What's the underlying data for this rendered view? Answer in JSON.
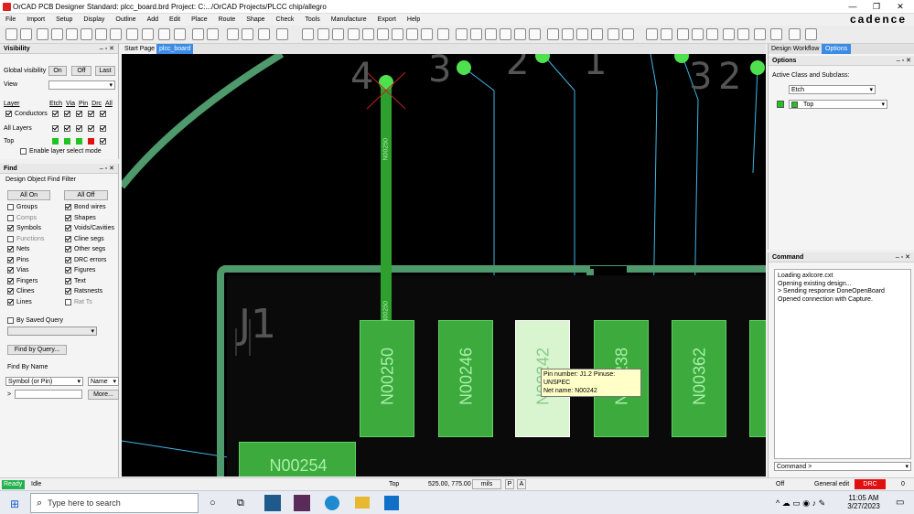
{
  "window": {
    "title": "OrCAD PCB Designer Standard: plcc_board.brd  Project: C:.../OrCAD Projects/PLCC chip/allegro",
    "min": "—",
    "max": "❐",
    "close": "✕",
    "brand": "cadence"
  },
  "menu": [
    "File",
    "Import",
    "Setup",
    "Display",
    "Outline",
    "Add",
    "Edit",
    "Place",
    "Route",
    "Shape",
    "Check",
    "Tools",
    "Manufacture",
    "Export",
    "Help"
  ],
  "tabs": {
    "start": "Start Page",
    "board": "plcc_board"
  },
  "visibility": {
    "title": "Visibility",
    "global_label": "Global visibility",
    "on": "On",
    "off": "Off",
    "last": "Last",
    "view_label": "View",
    "layer_label": "Layer",
    "cols": [
      "Etch",
      "Via",
      "Pin",
      "Drc",
      "All"
    ],
    "conductors": "Conductors",
    "all_layers": "All Layers",
    "top": "Top",
    "enable_layer_select": "Enable layer select mode"
  },
  "find": {
    "title": "Find",
    "filter_title": "Design Object Find Filter",
    "all_on": "All On",
    "all_off": "All Off",
    "left": [
      {
        "label": "Groups",
        "on": false
      },
      {
        "label": "Comps",
        "on": false,
        "dim": true
      },
      {
        "label": "Symbols",
        "on": true
      },
      {
        "label": "Functions",
        "on": false,
        "dim": true
      },
      {
        "label": "Nets",
        "on": true
      },
      {
        "label": "Pins",
        "on": true
      },
      {
        "label": "Vias",
        "on": true
      },
      {
        "label": "Fingers",
        "on": true
      },
      {
        "label": "Clines",
        "on": true
      },
      {
        "label": "Lines",
        "on": true
      }
    ],
    "right": [
      {
        "label": "Bond wires",
        "on": true
      },
      {
        "label": "Shapes",
        "on": true
      },
      {
        "label": "Voids/Cavities",
        "on": true
      },
      {
        "label": "Cline segs",
        "on": true
      },
      {
        "label": "Other segs",
        "on": true
      },
      {
        "label": "DRC errors",
        "on": true
      },
      {
        "label": "Figures",
        "on": true
      },
      {
        "label": "Text",
        "on": true
      },
      {
        "label": "Ratsnests",
        "on": true
      },
      {
        "label": "Rat Ts",
        "on": false,
        "dim": true
      }
    ],
    "by_saved_query": "By Saved Query",
    "find_by_query": "Find by Query...",
    "find_by_name": "Find By Name",
    "symbol_select": "Symbol (or Pin)",
    "name_select": "Name",
    "arrow": ">",
    "more": "More..."
  },
  "right_panel": {
    "tab_workflow": "Design Workflow",
    "tab_options": "Options",
    "options_title": "Options",
    "active_class_label": "Active Class and Subclass:",
    "class_value": "Etch",
    "subclass_value": "Top",
    "command_title": "Command",
    "command_log": [
      "Loading axlcore.cxt",
      "Opening existing design...",
      "> Sending response DoneOpenBoard",
      "Opened connection with Capture."
    ],
    "command_input": "Command >"
  },
  "canvas": {
    "pads": [
      "N00250",
      "N00246",
      "N00242",
      "N00238",
      "N00362",
      "N00254"
    ],
    "vertical_net": "N00250",
    "refdes": "J1",
    "pin_numbers": [
      "4",
      "3",
      "2",
      "1",
      "3",
      "2"
    ],
    "tooltip": {
      "line1": "Pin number: J1.2    Pinuse: UNSPEC",
      "line2": "Net name: N00242"
    }
  },
  "status": {
    "ready": "Ready",
    "idle": "Idle",
    "layer": "Top",
    "coords": "525.00, 775.00",
    "units": "mils",
    "p": "P",
    "a": "A",
    "off": "Off",
    "general_edit": "General edit",
    "drc": "DRC",
    "drc_count": "0"
  },
  "taskbar": {
    "search_placeholder": "Type here to search",
    "time": "11:05 AM",
    "date": "3/27/2023"
  },
  "colors": {
    "pad": "#3caa3c",
    "trace": "#2ea02e",
    "outline": "#4e9a6c",
    "ratsnest": "#3fb5e8",
    "ready": "#22b14c"
  }
}
